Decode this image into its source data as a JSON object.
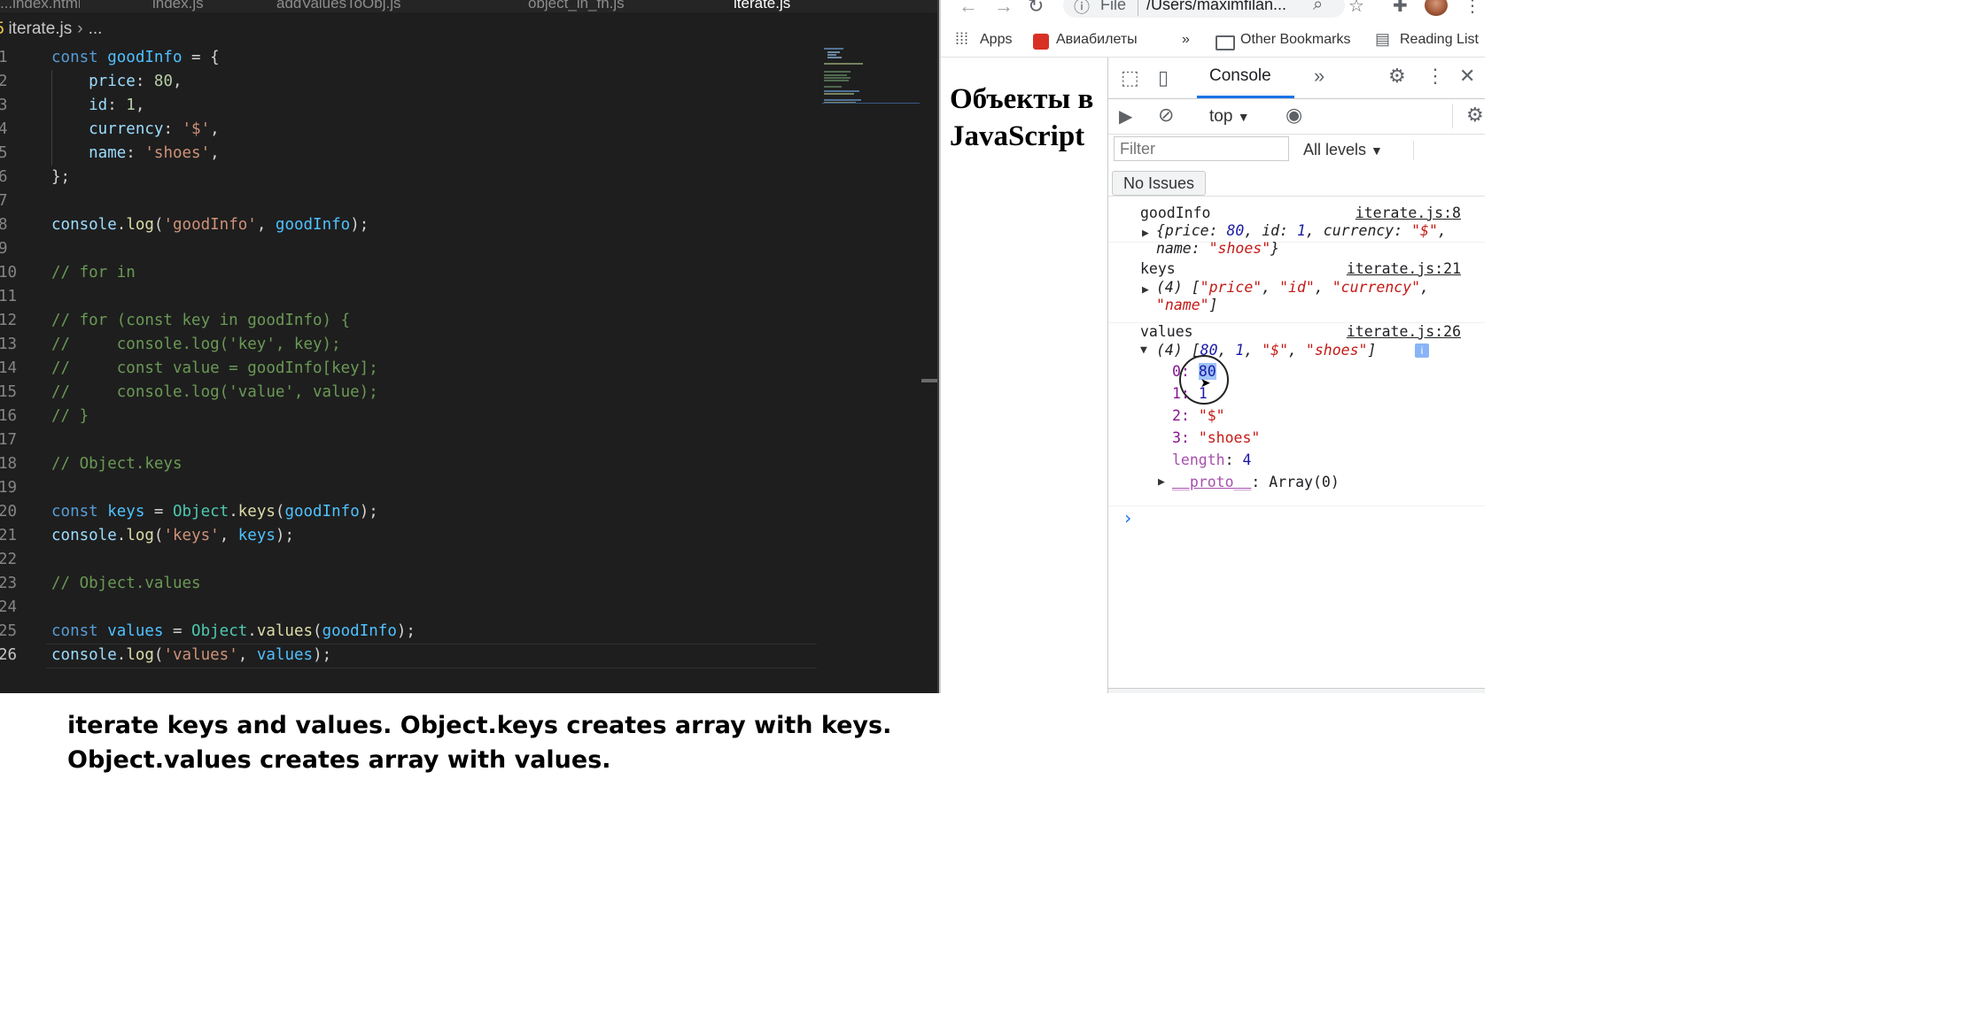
{
  "editor": {
    "tabs": [
      {
        "label": "...index.html",
        "active": false
      },
      {
        "label": "index.js",
        "active": false
      },
      {
        "label": "addValuesToObj.js",
        "active": false
      },
      {
        "label": "object_in_fn.js",
        "active": false
      },
      {
        "label": "iterate.js",
        "active": true
      }
    ],
    "breadcrumb_file": "iterate.js",
    "breadcrumb_more": "...",
    "lines": [
      {
        "n": "1",
        "tokens": [
          {
            "t": "const ",
            "c": "kw"
          },
          {
            "t": "goodInfo",
            "c": "var"
          },
          {
            "t": " = {",
            "c": "p"
          }
        ]
      },
      {
        "n": "2",
        "tokens": [
          {
            "t": "    price",
            "c": "prop"
          },
          {
            "t": ": ",
            "c": "p"
          },
          {
            "t": "80",
            "c": "num"
          },
          {
            "t": ",",
            "c": "p"
          }
        ]
      },
      {
        "n": "3",
        "tokens": [
          {
            "t": "    id",
            "c": "prop"
          },
          {
            "t": ": ",
            "c": "p"
          },
          {
            "t": "1",
            "c": "num"
          },
          {
            "t": ",",
            "c": "p"
          }
        ]
      },
      {
        "n": "4",
        "tokens": [
          {
            "t": "    currency",
            "c": "prop"
          },
          {
            "t": ": ",
            "c": "p"
          },
          {
            "t": "'$'",
            "c": "str"
          },
          {
            "t": ",",
            "c": "p"
          }
        ]
      },
      {
        "n": "5",
        "tokens": [
          {
            "t": "    name",
            "c": "prop"
          },
          {
            "t": ": ",
            "c": "p"
          },
          {
            "t": "'shoes'",
            "c": "str"
          },
          {
            "t": ",",
            "c": "p"
          }
        ]
      },
      {
        "n": "6",
        "tokens": [
          {
            "t": "};",
            "c": "p"
          }
        ]
      },
      {
        "n": "7",
        "tokens": []
      },
      {
        "n": "8",
        "tokens": [
          {
            "t": "console",
            "c": "prop"
          },
          {
            "t": ".",
            "c": "p"
          },
          {
            "t": "log",
            "c": "fn"
          },
          {
            "t": "(",
            "c": "p"
          },
          {
            "t": "'goodInfo'",
            "c": "str"
          },
          {
            "t": ", ",
            "c": "p"
          },
          {
            "t": "goodInfo",
            "c": "var"
          },
          {
            "t": ");",
            "c": "p"
          }
        ]
      },
      {
        "n": "9",
        "tokens": []
      },
      {
        "n": "10",
        "tokens": [
          {
            "t": "// for in",
            "c": "cm"
          }
        ]
      },
      {
        "n": "11",
        "tokens": []
      },
      {
        "n": "12",
        "tokens": [
          {
            "t": "// for (const key in goodInfo) {",
            "c": "cm"
          }
        ]
      },
      {
        "n": "13",
        "tokens": [
          {
            "t": "//     console.log('key', key);",
            "c": "cm"
          }
        ]
      },
      {
        "n": "14",
        "tokens": [
          {
            "t": "//     const value = goodInfo[key];",
            "c": "cm"
          }
        ]
      },
      {
        "n": "15",
        "tokens": [
          {
            "t": "//     console.log('value', value);",
            "c": "cm"
          }
        ]
      },
      {
        "n": "16",
        "tokens": [
          {
            "t": "// }",
            "c": "cm"
          }
        ]
      },
      {
        "n": "17",
        "tokens": []
      },
      {
        "n": "18",
        "tokens": [
          {
            "t": "// Object.keys",
            "c": "cm"
          }
        ]
      },
      {
        "n": "19",
        "tokens": []
      },
      {
        "n": "20",
        "tokens": [
          {
            "t": "const ",
            "c": "kw"
          },
          {
            "t": "keys",
            "c": "var"
          },
          {
            "t": " = ",
            "c": "p"
          },
          {
            "t": "Object",
            "c": "cls"
          },
          {
            "t": ".",
            "c": "p"
          },
          {
            "t": "keys",
            "c": "fn"
          },
          {
            "t": "(",
            "c": "p"
          },
          {
            "t": "goodInfo",
            "c": "var"
          },
          {
            "t": ");",
            "c": "p"
          }
        ]
      },
      {
        "n": "21",
        "tokens": [
          {
            "t": "console",
            "c": "prop"
          },
          {
            "t": ".",
            "c": "p"
          },
          {
            "t": "log",
            "c": "fn"
          },
          {
            "t": "(",
            "c": "p"
          },
          {
            "t": "'keys'",
            "c": "str"
          },
          {
            "t": ", ",
            "c": "p"
          },
          {
            "t": "keys",
            "c": "var"
          },
          {
            "t": ");",
            "c": "p"
          }
        ]
      },
      {
        "n": "22",
        "tokens": []
      },
      {
        "n": "23",
        "tokens": [
          {
            "t": "// Object.values",
            "c": "cm"
          }
        ]
      },
      {
        "n": "24",
        "tokens": []
      },
      {
        "n": "25",
        "tokens": [
          {
            "t": "const ",
            "c": "kw"
          },
          {
            "t": "values",
            "c": "var"
          },
          {
            "t": " = ",
            "c": "p"
          },
          {
            "t": "Object",
            "c": "cls"
          },
          {
            "t": ".",
            "c": "p"
          },
          {
            "t": "values",
            "c": "fn"
          },
          {
            "t": "(",
            "c": "p"
          },
          {
            "t": "goodInfo",
            "c": "var"
          },
          {
            "t": ");",
            "c": "p"
          }
        ]
      },
      {
        "n": "26",
        "tokens": [
          {
            "t": "console",
            "c": "prop"
          },
          {
            "t": ".",
            "c": "p"
          },
          {
            "t": "log",
            "c": "fn"
          },
          {
            "t": "(",
            "c": "p"
          },
          {
            "t": "'values'",
            "c": "str"
          },
          {
            "t": ", ",
            "c": "p"
          },
          {
            "t": "values",
            "c": "var"
          },
          {
            "t": ");",
            "c": "p"
          }
        ],
        "current": true
      }
    ]
  },
  "browser": {
    "url_scheme": "File",
    "url_text": "/Users/maximfilan...",
    "bookmarks": {
      "apps": "Apps",
      "aviabilety": "Авиабилеты",
      "more": "»",
      "other": "Other Bookmarks",
      "reading": "Reading List"
    },
    "page_title": "Объекты в JavaScript",
    "devtools": {
      "console_tab": "Console",
      "more_tabs": "»",
      "context": "top",
      "filter_placeholder": "Filter",
      "levels": "All levels",
      "no_issues": "No Issues",
      "messages": {
        "goodinfo_label": "goodInfo",
        "goodinfo_src": "iterate.js:8",
        "keys_label": "keys",
        "keys_src": "iterate.js:21",
        "values_label": "values",
        "values_src": "iterate.js:26"
      },
      "values_items": [
        {
          "index": "0",
          "value": "80"
        },
        {
          "index": "1",
          "value": "1"
        },
        {
          "index": "2",
          "value": "\"$\""
        },
        {
          "index": "3",
          "value": "\"shoes\""
        }
      ],
      "length_label": "length",
      "length_value": "4",
      "proto_label": "__proto__",
      "proto_value": "Array(0)",
      "prompt": "›"
    }
  },
  "caption": {
    "line1": "iterate keys and values. Object.keys creates array with keys.",
    "line2": "Object.values creates array with values."
  }
}
